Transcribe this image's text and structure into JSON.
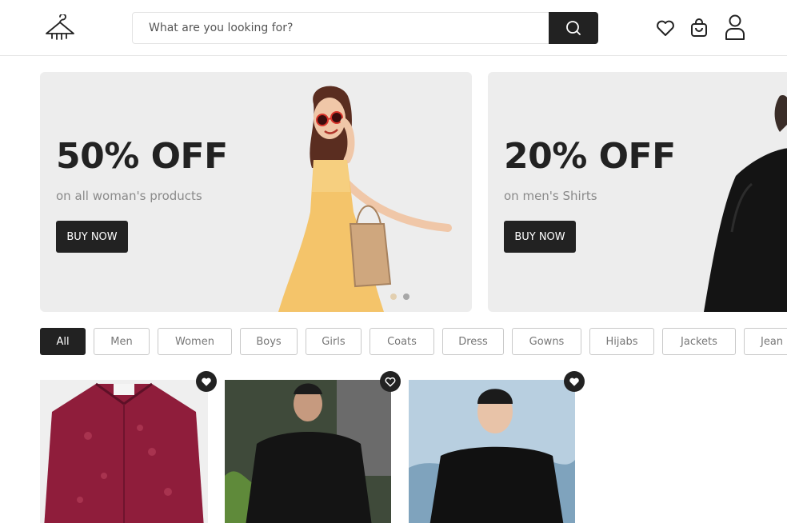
{
  "header": {
    "search_placeholder": "What are you looking for?",
    "icons": [
      "hanger-logo-icon",
      "search-icon",
      "heart-icon",
      "shopping-bag-icon",
      "user-icon"
    ]
  },
  "banners": [
    {
      "headline": "50% OFF",
      "subtitle": "on all woman's products",
      "button": "BUY NOW"
    },
    {
      "headline": "20% OFF",
      "subtitle": "on men's Shirts",
      "button": "BUY NOW"
    }
  ],
  "carousel": {
    "dot_count": 2,
    "active_index": 0
  },
  "categories": [
    "All",
    "Men",
    "Women",
    "Boys",
    "Girls",
    "Coats",
    "Dress",
    "Gowns",
    "Hijabs",
    "Jackets",
    "Jean"
  ],
  "selected_category": "All",
  "products": [
    {
      "image": "maroon shirt",
      "favorite": true
    },
    {
      "image": "man in black shirt with sunglasses",
      "favorite": false
    },
    {
      "image": "man in black shirt",
      "favorite": true
    }
  ],
  "colors": {
    "dark": "#222222",
    "banner_bg": "#ededed",
    "muted_text": "#8a8a8a",
    "border": "#c9c9c9"
  }
}
